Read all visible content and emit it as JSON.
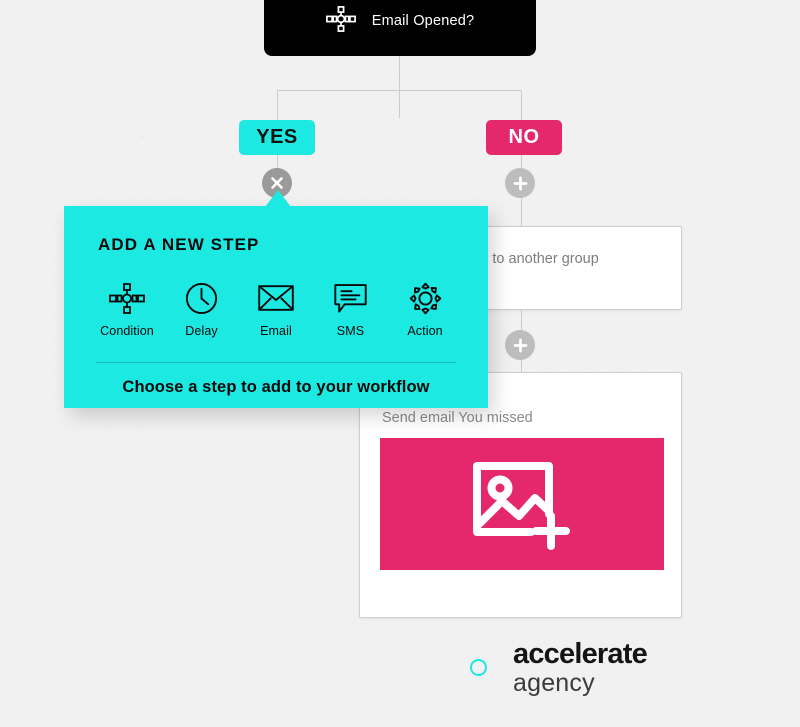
{
  "workflow": {
    "condition_node": {
      "icon": "condition-icon",
      "label": "Email Opened?"
    },
    "branches": [
      {
        "id": "yes",
        "label": "YES",
        "bg_color": "#1ce9e2",
        "text_color": "#111111"
      },
      {
        "id": "no",
        "label": "NO",
        "bg_color": "#e5276b",
        "text_color": "#ffffff"
      }
    ],
    "round_buttons": [
      {
        "id": "close-yes",
        "icon": "close-icon",
        "branch": "yes"
      },
      {
        "id": "add-no",
        "icon": "plus-icon",
        "branch": "no"
      },
      {
        "id": "add-mid",
        "icon": "plus-icon",
        "branch": "no"
      }
    ],
    "cards": [
      {
        "id": "move-subscriber",
        "text": "Move subscriber to another group"
      },
      {
        "id": "send-email",
        "text": "Send email You missed",
        "image_placeholder_icon": "add-image-icon",
        "image_placeholder_color": "#e5276b"
      }
    ]
  },
  "add_step_popup": {
    "title": "ADD A NEW STEP",
    "bg_color": "#1ce9e2",
    "footer": "Choose a step to add to your workflow",
    "options": [
      {
        "label": "Condition",
        "icon": "condition-icon"
      },
      {
        "label": "Delay",
        "icon": "clock-icon"
      },
      {
        "label": "Email",
        "icon": "envelope-icon"
      },
      {
        "label": "SMS",
        "icon": "speech-bubble-icon"
      },
      {
        "label": "Action",
        "icon": "gear-icon"
      }
    ]
  },
  "brand": {
    "name": "accelerate",
    "sub": "agency",
    "mark_color": "#1ce9e2",
    "mark_icon": "circle-outline-icon"
  }
}
